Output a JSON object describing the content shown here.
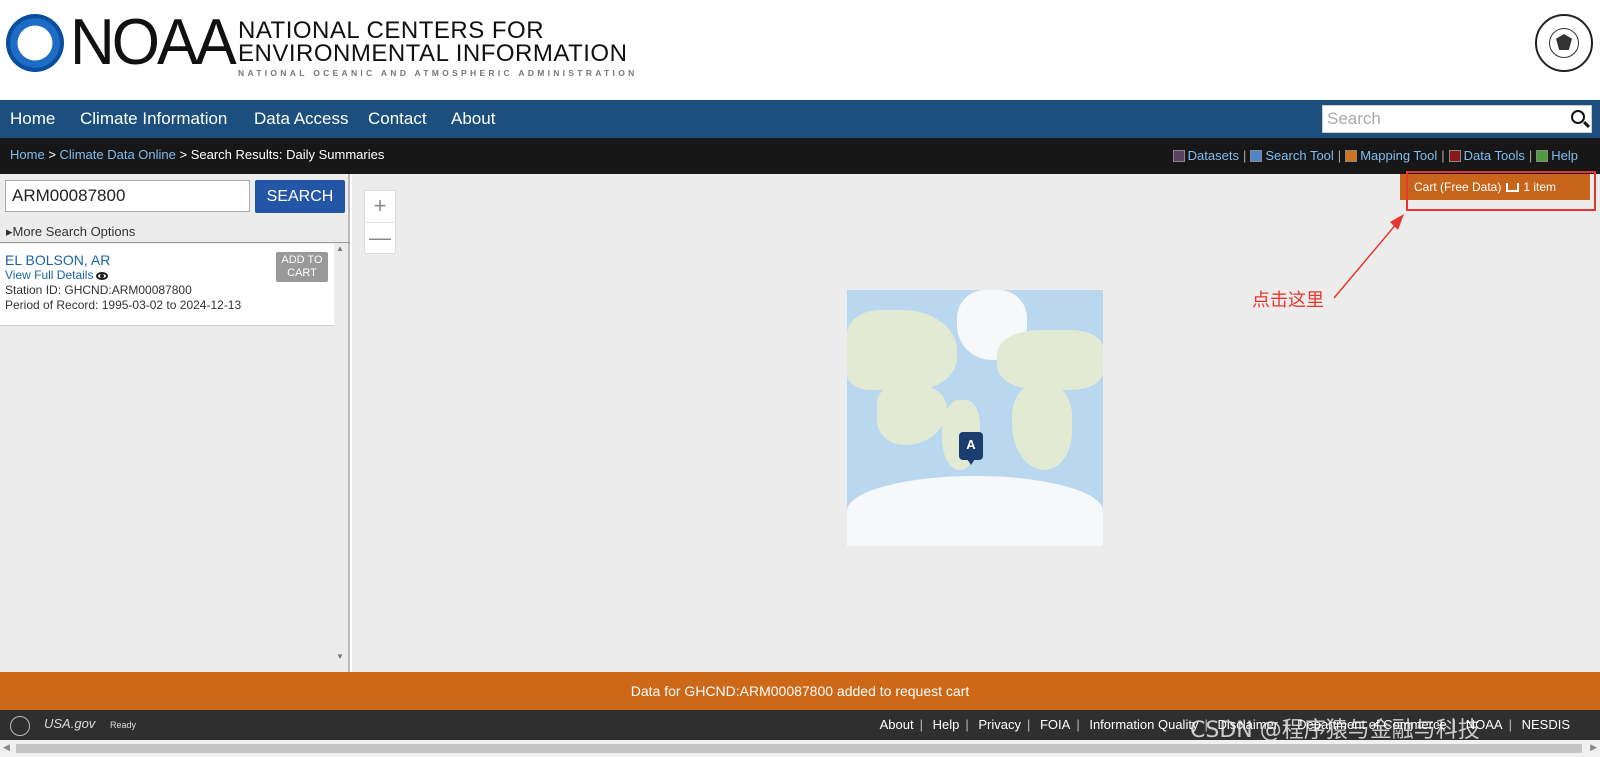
{
  "header": {
    "brand": "NOAA",
    "line1": "NATIONAL CENTERS FOR",
    "line2": "ENVIRONMENTAL INFORMATION",
    "line3": "NATIONAL OCEANIC AND ATMOSPHERIC ADMINISTRATION",
    "logo_text": "NOAA"
  },
  "nav": {
    "items": [
      "Home",
      "Climate Information",
      "Data Access",
      "Contact",
      "About"
    ],
    "search_placeholder": "Search"
  },
  "breadcrumb": {
    "home": "Home",
    "sep1": ">",
    "cdo": "Climate Data Online",
    "sep2": ">",
    "current": "Search Results: Daily Summaries"
  },
  "tools": [
    {
      "label": "Datasets",
      "color": "#5b3f63"
    },
    {
      "label": "Search Tool",
      "color": "#4a86c9"
    },
    {
      "label": "Mapping Tool",
      "color": "#d1731f"
    },
    {
      "label": "Data Tools",
      "color": "#8a1a1a"
    },
    {
      "label": "Help",
      "color": "#4f9a3a"
    }
  ],
  "left": {
    "input_value": "ARM00087800",
    "search_button": "SEARCH",
    "more_options": "More Search Options",
    "result": {
      "title": "EL BOLSON, AR",
      "view_details": "View Full Details",
      "station_id": "Station ID: GHCND:ARM00087800",
      "period": "Period of Record:  1995-03-02 to 2024-12-13",
      "add_to_cart": "ADD TO CART"
    }
  },
  "map": {
    "zoom_in": "+",
    "zoom_out": "—",
    "cart_label": "Cart (Free Data)",
    "cart_count": "1 item",
    "annotation": "点击这里",
    "marker_letter": "A"
  },
  "status": {
    "message": "Data for GHCND:ARM00087800 added to request cart"
  },
  "footer": {
    "usa": "USA.gov",
    "ready": "Ready",
    "links": [
      "About",
      "Help",
      "Privacy",
      "FOIA",
      "Information Quality",
      "Disclaimer",
      "Department of Commerce",
      "NOAA",
      "NESDIS"
    ],
    "watermark": "CSDN @程序猿与金融与科技"
  },
  "colors": {
    "nav_bg": "#1c4e7e",
    "accent_orange": "#cc6817",
    "link_blue": "#1a63a8",
    "annotation_red": "#e8362f"
  }
}
